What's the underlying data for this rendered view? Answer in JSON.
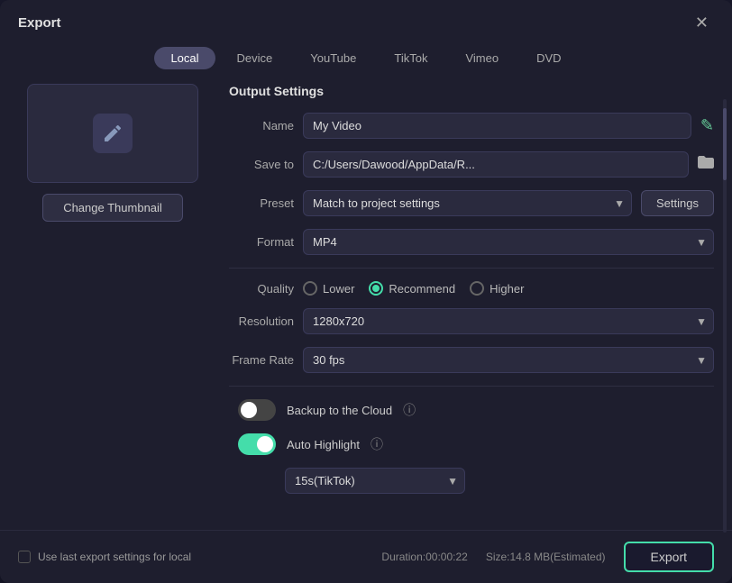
{
  "dialog": {
    "title": "Export",
    "close_label": "✕"
  },
  "tabs": [
    {
      "id": "local",
      "label": "Local",
      "active": true
    },
    {
      "id": "device",
      "label": "Device",
      "active": false
    },
    {
      "id": "youtube",
      "label": "YouTube",
      "active": false
    },
    {
      "id": "tiktok",
      "label": "TikTok",
      "active": false
    },
    {
      "id": "vimeo",
      "label": "Vimeo",
      "active": false
    },
    {
      "id": "dvd",
      "label": "DVD",
      "active": false
    }
  ],
  "thumbnail": {
    "change_label": "Change Thumbnail"
  },
  "output_settings": {
    "title": "Output Settings",
    "name_label": "Name",
    "name_value": "My Video",
    "save_to_label": "Save to",
    "save_to_value": "C:/Users/Dawood/AppData/R...",
    "preset_label": "Preset",
    "preset_value": "Match to project settings",
    "settings_label": "Settings",
    "format_label": "Format",
    "format_value": "MP4",
    "quality_label": "Quality",
    "quality_options": [
      {
        "id": "lower",
        "label": "Lower",
        "selected": false
      },
      {
        "id": "recommend",
        "label": "Recommend",
        "selected": true
      },
      {
        "id": "higher",
        "label": "Higher",
        "selected": false
      }
    ],
    "resolution_label": "Resolution",
    "resolution_value": "1280x720",
    "frame_rate_label": "Frame Rate",
    "frame_rate_value": "30 fps",
    "backup_cloud_label": "Backup to the Cloud",
    "auto_highlight_label": "Auto Highlight",
    "highlight_select_value": "15s(TikTok)"
  },
  "footer": {
    "checkbox_label": "Use last export settings for local",
    "duration_label": "Duration:00:00:22",
    "size_label": "Size:14.8 MB(Estimated)",
    "export_label": "Export"
  }
}
